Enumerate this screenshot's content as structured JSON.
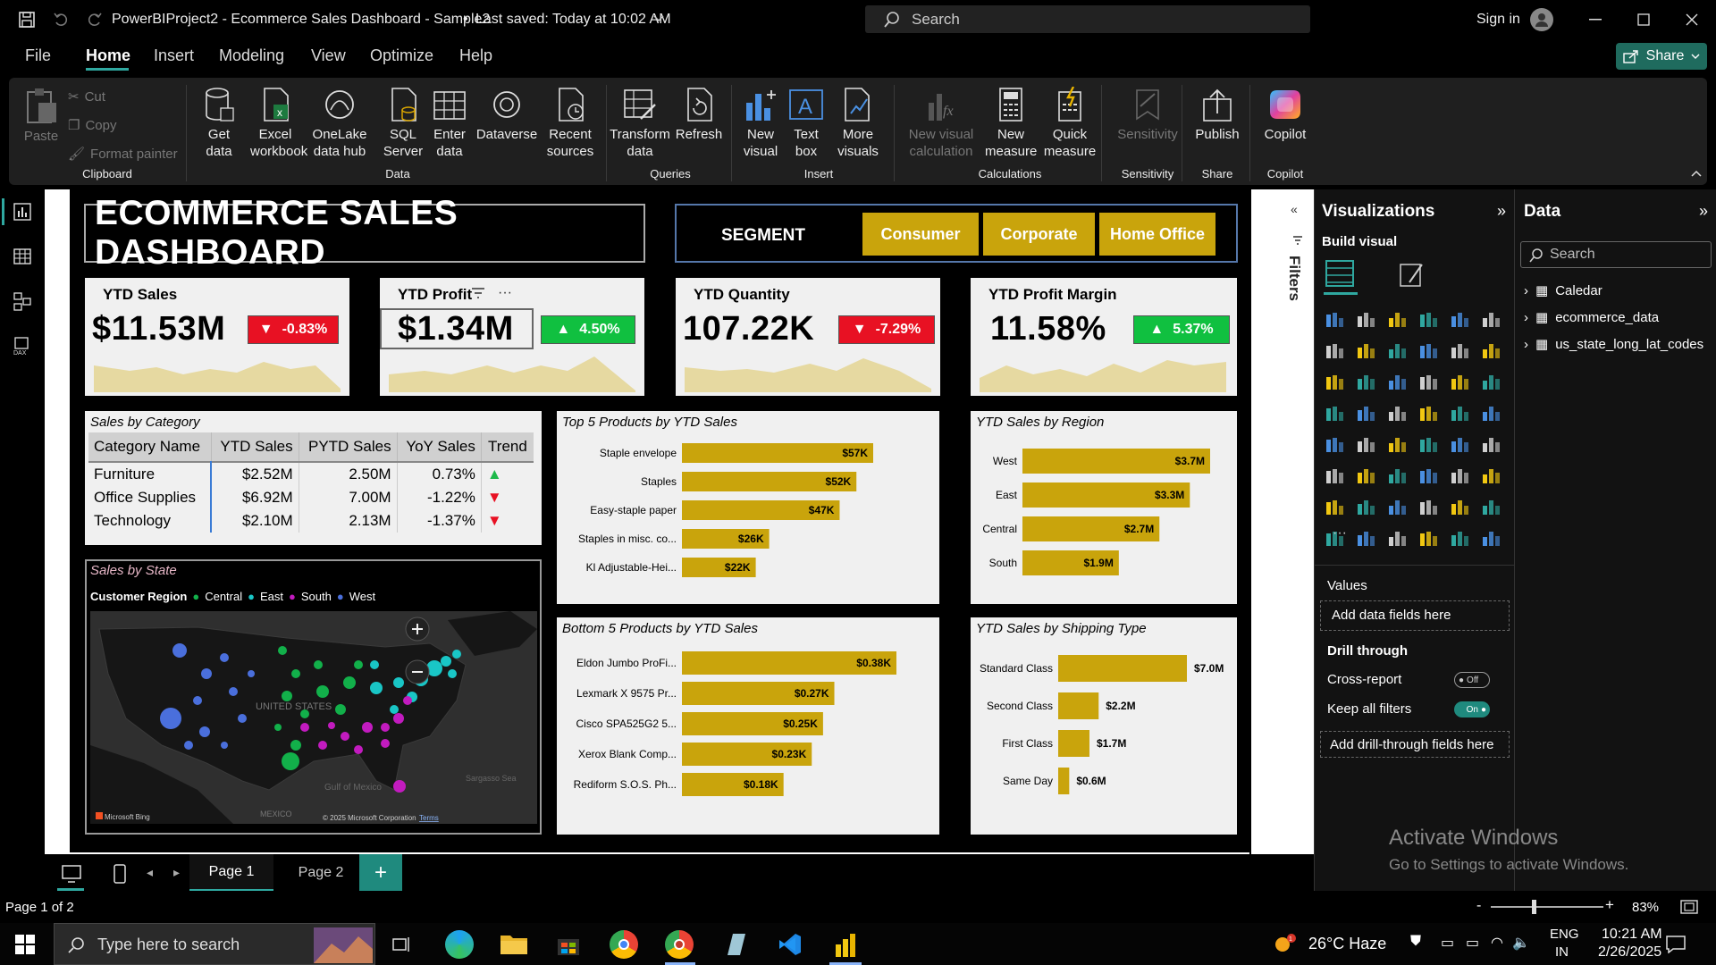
{
  "window": {
    "title": "PowerBIProject2 - Ecommerce Sales Dashboard - Sample2",
    "saved": "Last saved: Today at 10:02 AM",
    "search_label": "Search",
    "signin": "Sign in"
  },
  "menu": {
    "items": [
      "File",
      "Home",
      "Insert",
      "Modeling",
      "View",
      "Optimize",
      "Help"
    ],
    "active": "Home",
    "share": "Share"
  },
  "ribbon": {
    "clipboard": {
      "paste": "Paste",
      "cut": "Cut",
      "copy": "Copy",
      "format_painter": "Format painter",
      "group": "Clipboard"
    },
    "data": {
      "get_data": "Get",
      "get_data2": "data",
      "excel": "Excel",
      "excel2": "workbook",
      "onelake": "OneLake",
      "onelake2": "data hub",
      "sql": "SQL",
      "sql2": "Server",
      "enter": "Enter",
      "enter2": "data",
      "dataverse": "Dataverse",
      "recent": "Recent",
      "recent2": "sources",
      "group": "Data"
    },
    "queries": {
      "transform": "Transform",
      "transform2": "data",
      "refresh": "Refresh",
      "group": "Queries"
    },
    "insert": {
      "new_visual": "New",
      "new_visual2": "visual",
      "text_box": "Text",
      "text_box2": "box",
      "more": "More",
      "more2": "visuals",
      "group": "Insert"
    },
    "calculations": {
      "nvc": "New visual",
      "nvc2": "calculation",
      "nm": "New",
      "nm2": "measure",
      "qm": "Quick",
      "qm2": "measure",
      "group": "Calculations"
    },
    "sensitivity": {
      "label": "Sensitivity",
      "group": "Sensitivity"
    },
    "share": {
      "publish": "Publish",
      "group": "Share"
    },
    "copilot": {
      "label": "Copilot",
      "group": "Copilot"
    }
  },
  "dashboard": {
    "title": "ECOMMERCE SALES DASHBOARD",
    "segment_label": "SEGMENT",
    "segments": [
      "Consumer",
      "Corporate",
      "Home Office"
    ],
    "kpis": [
      {
        "title": "YTD Sales",
        "value": "$11.53M",
        "change": "-0.83%",
        "direction": "down"
      },
      {
        "title": "YTD Profit",
        "value": "$1.34M",
        "change": "4.50%",
        "direction": "up"
      },
      {
        "title": "YTD Quantity",
        "value": "107.22K",
        "change": "-7.29%",
        "direction": "down"
      },
      {
        "title": "YTD Profit Margin",
        "value": "11.58%",
        "change": "5.37%",
        "direction": "up"
      }
    ],
    "category_table": {
      "title": "Sales by Category",
      "headers": [
        "Category Name",
        "YTD Sales",
        "PYTD Sales",
        "YoY Sales",
        "Trend"
      ],
      "rows": [
        [
          "Furniture",
          "$2.52M",
          "2.50M",
          "0.73%",
          "up"
        ],
        [
          "Office Supplies",
          "$6.92M",
          "7.00M",
          "-1.22%",
          "down"
        ],
        [
          "Technology",
          "$2.10M",
          "2.13M",
          "-1.37%",
          "down"
        ]
      ]
    },
    "map": {
      "title": "Sales by State",
      "legend_title": "Customer Region",
      "legend": [
        {
          "name": "Central",
          "color": "#12b04a"
        },
        {
          "name": "East",
          "color": "#19c6c6"
        },
        {
          "name": "South",
          "color": "#c21bbf"
        },
        {
          "name": "West",
          "color": "#4a6fdc"
        }
      ],
      "country": "UNITED STATES",
      "gulf": "Gulf of Mexico",
      "sea": "Sargasso Sea",
      "mexico": "MEXICO",
      "bing": "Microsoft Bing",
      "copyright": "© 2025 Microsoft Corporation",
      "terms": "Terms"
    }
  },
  "chart_data": [
    {
      "type": "bar",
      "title": "Top 5 Products by YTD Sales",
      "categories": [
        "Staple envelope",
        "Staples",
        "Easy-staple paper",
        "Staples in misc. co...",
        "Kl Adjustable-Hei..."
      ],
      "values": [
        57,
        52,
        47,
        26,
        22
      ],
      "labels": [
        "$57K",
        "$52K",
        "$47K",
        "$26K",
        "$22K"
      ]
    },
    {
      "type": "bar",
      "title": "YTD Sales by Region",
      "categories": [
        "West",
        "East",
        "Central",
        "South"
      ],
      "values": [
        3.7,
        3.3,
        2.7,
        1.9
      ],
      "labels": [
        "$3.7M",
        "$3.3M",
        "$2.7M",
        "$1.9M"
      ]
    },
    {
      "type": "bar",
      "title": "Bottom 5 Products by YTD Sales",
      "categories": [
        "Eldon Jumbo ProFi...",
        "Lexmark X 9575 Pr...",
        "Cisco SPA525G2 5...",
        "Xerox Blank Comp...",
        "Rediform S.O.S. Ph..."
      ],
      "values": [
        0.38,
        0.27,
        0.25,
        0.23,
        0.18
      ],
      "labels": [
        "$0.38K",
        "$0.27K",
        "$0.25K",
        "$0.23K",
        "$0.18K"
      ]
    },
    {
      "type": "bar",
      "title": "YTD Sales by Shipping Type",
      "categories": [
        "Standard Class",
        "Second Class",
        "First Class",
        "Same Day"
      ],
      "values": [
        7.0,
        2.2,
        1.7,
        0.6
      ],
      "labels": [
        "$7.0M",
        "$2.2M",
        "$1.7M",
        "$0.6M"
      ]
    }
  ],
  "filters_label": "Filters",
  "visualizations": {
    "title": "Visualizations",
    "build": "Build visual",
    "values": "Values",
    "add_fields": "Add data fields here",
    "drill": "Drill through",
    "cross_report": "Cross-report",
    "cross_state": "Off",
    "keep_filters": "Keep all filters",
    "keep_state": "On",
    "add_drill": "Add drill-through fields here"
  },
  "data_pane": {
    "title": "Data",
    "search": "Search",
    "tables": [
      "Caledar",
      "ecommerce_data",
      "us_state_long_lat_codes"
    ]
  },
  "pages": {
    "tabs": [
      "Page 1",
      "Page 2"
    ],
    "status": "Page 1 of 2",
    "zoom": "83%"
  },
  "watermark": {
    "line1": "Activate Windows",
    "line2": "Go to Settings to activate Windows."
  },
  "taskbar": {
    "search": "Type here to search",
    "weather": "26°C  Haze",
    "lang1": "ENG",
    "lang2": "IN",
    "time": "10:21 AM",
    "date": "2/26/2025"
  }
}
